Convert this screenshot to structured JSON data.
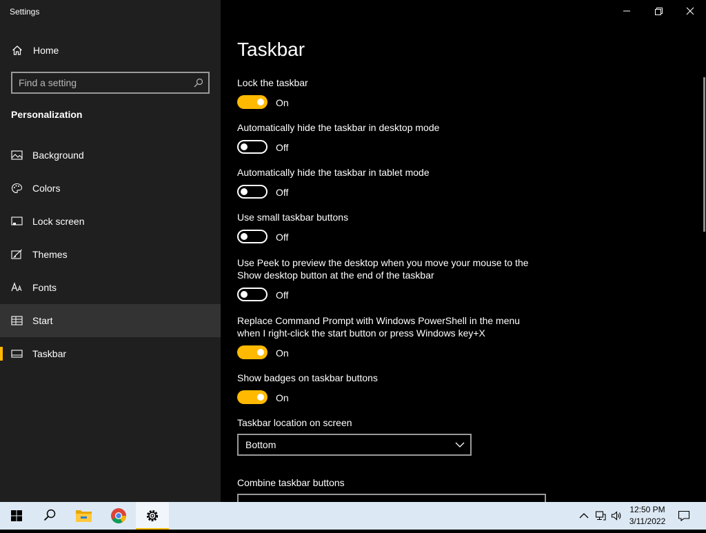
{
  "window": {
    "title": "Settings"
  },
  "sidebar": {
    "home_label": "Home",
    "search_placeholder": "Find a setting",
    "section_title": "Personalization",
    "items": [
      {
        "label": "Background",
        "icon": "picture-icon"
      },
      {
        "label": "Colors",
        "icon": "palette-icon"
      },
      {
        "label": "Lock screen",
        "icon": "lock-screen-icon"
      },
      {
        "label": "Themes",
        "icon": "themes-brush-icon"
      },
      {
        "label": "Fonts",
        "icon": "fonts-icon"
      },
      {
        "label": "Start",
        "icon": "start-grid-icon"
      },
      {
        "label": "Taskbar",
        "icon": "taskbar-icon"
      }
    ],
    "selected": "Taskbar",
    "hovered": "Start"
  },
  "main": {
    "title": "Taskbar",
    "settings": [
      {
        "label": "Lock the taskbar",
        "state": "On"
      },
      {
        "label": "Automatically hide the taskbar in desktop mode",
        "state": "Off"
      },
      {
        "label": "Automatically hide the taskbar in tablet mode",
        "state": "Off"
      },
      {
        "label": "Use small taskbar buttons",
        "state": "Off"
      },
      {
        "label": "Use Peek to preview the desktop when you move your mouse to the Show desktop button at the end of the taskbar",
        "state": "Off"
      },
      {
        "label": "Replace Command Prompt with Windows PowerShell in the menu when I right-click the start button or press Windows key+X",
        "state": "On"
      },
      {
        "label": "Show badges on taskbar buttons",
        "state": "On"
      }
    ],
    "location_label": "Taskbar location on screen",
    "location_value": "Bottom",
    "combine_label": "Combine taskbar buttons"
  },
  "taskbar": {
    "apps": [
      "windows-start-icon",
      "search-icon",
      "file-explorer-icon",
      "chrome-icon",
      "settings-gear-icon"
    ],
    "clock_time": "12:50 PM",
    "clock_date": "3/11/2022"
  },
  "colors": {
    "accent": "#ffb900",
    "sidebar_bg": "#1f1f1f",
    "main_bg": "#000000",
    "taskbar_bg": "#dce9f4"
  }
}
